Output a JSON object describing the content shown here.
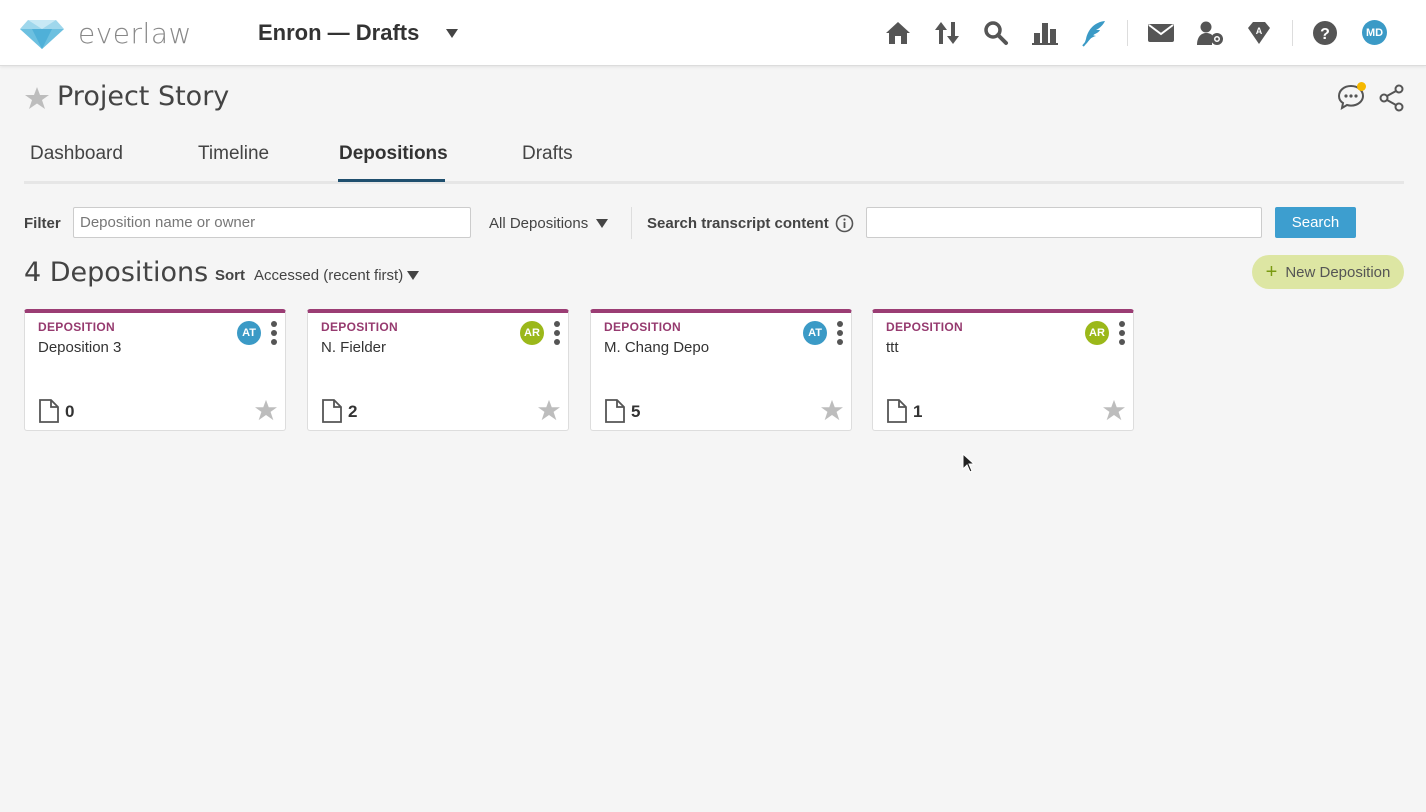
{
  "header": {
    "brand": "everlaw",
    "project": "Enron — Drafts",
    "nav_icons": [
      "home-icon",
      "transfer-icon",
      "search-icon",
      "analytics-icon",
      "story-feather-icon",
      "messages-icon",
      "user-admin-icon",
      "project-admin-icon",
      "help-icon"
    ],
    "user_initials": "MD",
    "accent_color": "#3b9ac6"
  },
  "page": {
    "title": "Project Story"
  },
  "tabs": [
    {
      "label": "Dashboard"
    },
    {
      "label": "Timeline"
    },
    {
      "label": "Depositions"
    },
    {
      "label": "Drafts"
    }
  ],
  "active_tab": "Depositions",
  "filter": {
    "label": "Filter",
    "placeholder": "Deposition name or owner",
    "scope": "All Depositions",
    "search_label": "Search transcript content",
    "search_value": "",
    "search_button": "Search"
  },
  "list": {
    "count_title": "4 Depositions",
    "sort_label": "Sort",
    "sort_value": "Accessed (recent first)",
    "new_button": "New Deposition"
  },
  "cards": [
    {
      "tag": "DEPOSITION",
      "name": "Deposition 3",
      "owner": "AT",
      "owner_color": "#3b9ac6",
      "docs": "0"
    },
    {
      "tag": "DEPOSITION",
      "name": "N. Fielder",
      "owner": "AR",
      "owner_color": "#9bb81a",
      "docs": "2"
    },
    {
      "tag": "DEPOSITION",
      "name": "M. Chang Depo",
      "owner": "AT",
      "owner_color": "#3b9ac6",
      "docs": "5"
    },
    {
      "tag": "DEPOSITION",
      "name": "ttt",
      "owner": "AR",
      "owner_color": "#9bb81a",
      "docs": "1"
    }
  ]
}
